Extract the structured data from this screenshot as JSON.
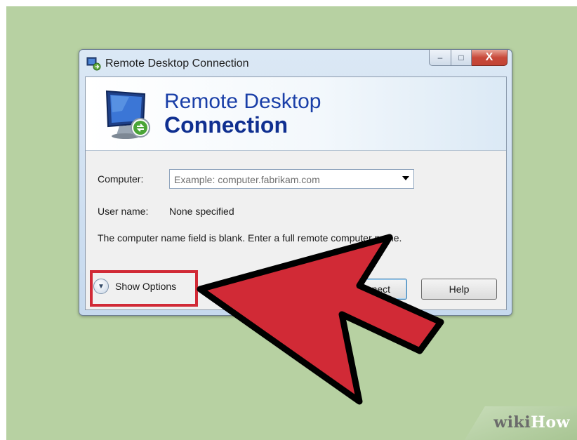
{
  "window": {
    "title": "Remote Desktop Connection",
    "buttons": {
      "minimize": "–",
      "maximize": "□",
      "close": "X"
    }
  },
  "banner": {
    "line1": "Remote Desktop",
    "line2": "Connection"
  },
  "form": {
    "computer_label": "Computer:",
    "computer_placeholder": "Example: computer.fabrikam.com",
    "username_label": "User name:",
    "username_value": "None specified",
    "message": "The computer name field is blank. Enter a full remote computer name."
  },
  "footer": {
    "show_options_label": "Show Options",
    "connect_label": "Connect",
    "help_label": "Help"
  },
  "annotation": {
    "arrow_color": "#d12a36",
    "highlight_color": "#d12a36"
  },
  "watermark": {
    "wiki": "wiki",
    "how": "How"
  },
  "icons": [
    "remote-desktop-icon",
    "monitor-icon",
    "chevron-down-icon",
    "dropdown-arrow-icon"
  ]
}
